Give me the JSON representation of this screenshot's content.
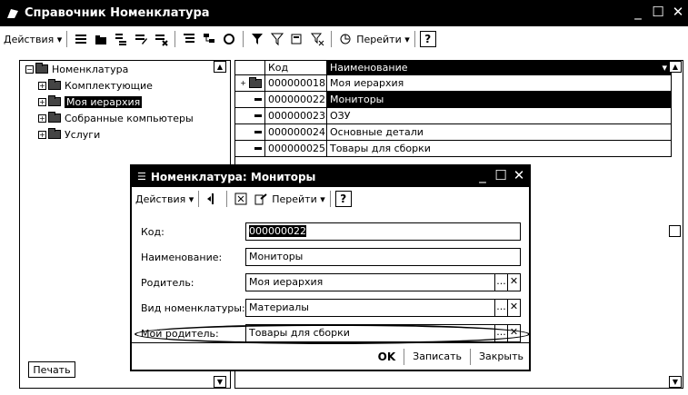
{
  "main_window": {
    "title": "Справочник Номенклатура",
    "toolbar": {
      "actions_label": "Действия ▾",
      "goto_label": "Перейти ▾",
      "help_label": "?"
    }
  },
  "tree": {
    "items": [
      {
        "label": "Номенклатура",
        "level": 0,
        "expanded": true
      },
      {
        "label": "Комплектующие",
        "level": 1
      },
      {
        "label": "Моя иерархия",
        "level": 1,
        "selected": true
      },
      {
        "label": "Собранные компьютеры",
        "level": 1
      },
      {
        "label": "Услуги",
        "level": 1
      }
    ],
    "print_label": "Печать"
  },
  "list": {
    "columns": [
      "Код",
      "Наименование"
    ],
    "rows": [
      {
        "code": "000000018",
        "name": "Моя иерархия",
        "is_group": true
      },
      {
        "code": "000000022",
        "name": "Мониторы",
        "selected": true
      },
      {
        "code": "000000023",
        "name": "ОЗУ"
      },
      {
        "code": "000000024",
        "name": "Основные детали"
      },
      {
        "code": "000000025",
        "name": "Товары для сборки"
      }
    ]
  },
  "dialog": {
    "title": "Номенклатура: Мониторы",
    "toolbar": {
      "actions_label": "Действия ▾",
      "goto_label": "Перейти ▾",
      "help_label": "?"
    },
    "fields": {
      "code": {
        "label": "Код:",
        "value": "000000022"
      },
      "name": {
        "label": "Наименование:",
        "value": "Мониторы"
      },
      "parent": {
        "label": "Родитель:",
        "value": "Моя иерархия"
      },
      "kind": {
        "label": "Вид номенклатуры:",
        "value": "Материалы"
      },
      "my_parent": {
        "label": "Мой родитель:",
        "value": "Товары для сборки"
      }
    },
    "buttons": {
      "ok": "OK",
      "save": "Записать",
      "close": "Закрыть"
    }
  },
  "colors": {
    "titlebar": "#000000",
    "selection": "#000000",
    "background": "#ffffff"
  }
}
